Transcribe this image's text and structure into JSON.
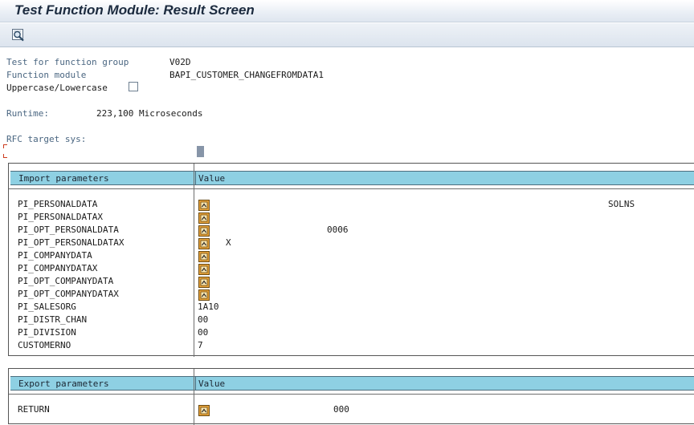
{
  "window": {
    "title": "Test Function Module: Result Screen"
  },
  "toolbar": {
    "icons": [
      "find-icon"
    ]
  },
  "info": {
    "fgroup_label": "Test for function group",
    "fgroup_value": "V02D",
    "fmodule_label": "Function module",
    "fmodule_value": "BAPI_CUSTOMER_CHANGEFROMDATA1",
    "case_label": "Uppercase/Lowercase",
    "case_checked": false,
    "runtime_label": "Runtime:",
    "runtime_value": "223,100 Microseconds",
    "rfc_label": "RFC target sys:",
    "rfc_value": ""
  },
  "import": {
    "header_param": "Import parameters",
    "header_value": "Value",
    "rows": [
      {
        "name": "PI_PERSONALDATA",
        "icon": true,
        "value": "SOLNS"
      },
      {
        "name": "PI_PERSONALDATAX",
        "icon": true,
        "value": ""
      },
      {
        "name": "PI_OPT_PERSONALDATA",
        "icon": true,
        "value": "0006"
      },
      {
        "name": "PI_OPT_PERSONALDATAX",
        "icon": true,
        "value": "X"
      },
      {
        "name": "PI_COMPANYDATA",
        "icon": true,
        "value": ""
      },
      {
        "name": "PI_COMPANYDATAX",
        "icon": true,
        "value": ""
      },
      {
        "name": "PI_OPT_COMPANYDATA",
        "icon": true,
        "value": ""
      },
      {
        "name": "PI_OPT_COMPANYDATAX",
        "icon": true,
        "value": ""
      },
      {
        "name": "PI_SALESORG",
        "icon": false,
        "value": "1A10"
      },
      {
        "name": "PI_DISTR_CHAN",
        "icon": false,
        "value": "00"
      },
      {
        "name": "PI_DIVISION",
        "icon": false,
        "value": "00"
      },
      {
        "name": "CUSTOMERNO",
        "icon": false,
        "value": "7"
      }
    ]
  },
  "export": {
    "header_param": "Export parameters",
    "header_value": "Value",
    "rows": [
      {
        "name": "RETURN",
        "icon": true,
        "value": "000"
      }
    ]
  },
  "colors": {
    "header_bg": "#8ed0e3",
    "label_text": "#4a6681",
    "icon_orange": "#e8a33a"
  }
}
